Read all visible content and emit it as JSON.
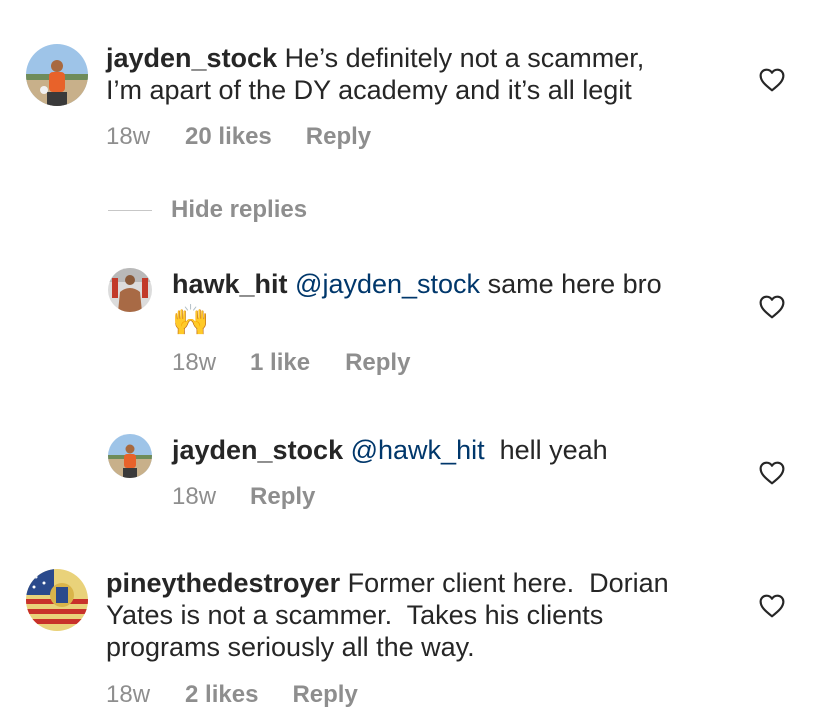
{
  "comments": [
    {
      "username": "jayden_stock",
      "text": " He’s definitely not a scammer,",
      "text_line2": "I’m apart of the DY academy and it’s all legit",
      "time": "18w",
      "likes": "20 likes",
      "reply": "Reply"
    },
    {
      "username": "pineythedestroyer",
      "text": " Former client here.  Dorian",
      "text_line2": "Yates is not a scammer.  Takes his clients",
      "text_line3": "programs seriously all the way.",
      "time": "18w",
      "likes": "2 likes",
      "reply": "Reply"
    }
  ],
  "hide_replies": "Hide replies",
  "replies": [
    {
      "username": "hawk_hit",
      "mention": "@jayden_stock",
      "text": " same here bro",
      "emoji": "🙌",
      "time": "18w",
      "likes": "1 like",
      "reply": "Reply"
    },
    {
      "username": "jayden_stock",
      "mention": "@hawk_hit",
      "text": "  hell yeah",
      "time": "18w",
      "reply": "Reply"
    }
  ],
  "icons": {
    "like": "heart-icon"
  },
  "colors": {
    "text": "#262626",
    "secondary": "#8e8e8e",
    "mention": "#00376b"
  }
}
